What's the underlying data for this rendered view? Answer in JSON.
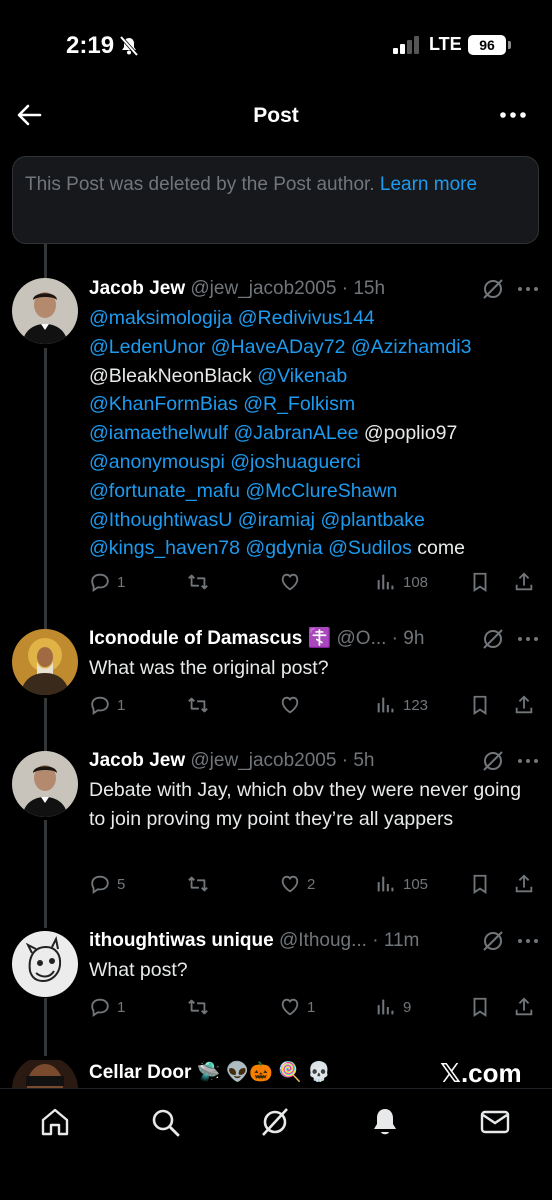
{
  "status_bar": {
    "time": "2:19",
    "network": "LTE",
    "battery": "96"
  },
  "header": {
    "title": "Post"
  },
  "deleted_notice": {
    "text": "This Post was deleted by the Post author.",
    "link": "Learn more"
  },
  "posts": [
    {
      "name": "Jacob Jew",
      "handle": "@jew_jacob2005",
      "time": "15h",
      "body_lines": [
        [
          "@maksimologija",
          " ",
          "@Redivivus144"
        ],
        [
          "@LedenUnor",
          " ",
          "@HaveADay72",
          " ",
          "@Azizhamdi3"
        ],
        [
          "@BleakNeonBlack",
          " ",
          "@Vikenab"
        ],
        [
          "@KhanFormBias",
          " ",
          "@R_Folkism"
        ],
        [
          "@iamaethelwulf",
          " ",
          "@JabranALee",
          " ",
          "@poplio97"
        ],
        [
          "@anonymouspi",
          " ",
          "@joshuaguerci"
        ],
        [
          "@fortunate_mafu",
          " ",
          "@McClureShawn"
        ],
        [
          "@IthoughtiwasU",
          " ",
          "@iramiaj",
          " ",
          "@plantbake"
        ],
        [
          "@kings_haven78",
          " ",
          "@gdynia",
          " ",
          "@Sudilos",
          " come"
        ]
      ],
      "replies": "1",
      "reposts": "",
      "likes": "",
      "views": "108"
    },
    {
      "name": "Iconodule of Damascus ☦️",
      "handle": "@O...",
      "time": "9h",
      "body": "What was the original post?",
      "replies": "1",
      "reposts": "",
      "likes": "",
      "views": "123"
    },
    {
      "name": "Jacob Jew",
      "handle": "@jew_jacob2005",
      "time": "5h",
      "body": "Debate with Jay, which obv they were never going to join proving my point they’re all yappers",
      "replies": "5",
      "reposts": "",
      "likes": "2",
      "views": "105"
    },
    {
      "name": "ithoughtiwas unique",
      "handle": "@Ithoug...",
      "time": "11m",
      "body": "What post?",
      "replies": "1",
      "reposts": "",
      "likes": "1",
      "views": "9"
    },
    {
      "name": "Cellar Door 🛸 👽🎃 🍭 💀"
    }
  ],
  "watermark": "𝕏.com",
  "tabs": [
    "home",
    "search",
    "grok",
    "notifications",
    "messages"
  ],
  "colors": {
    "accent": "#1d9bf0",
    "muted": "#71767b",
    "background": "#000000"
  }
}
